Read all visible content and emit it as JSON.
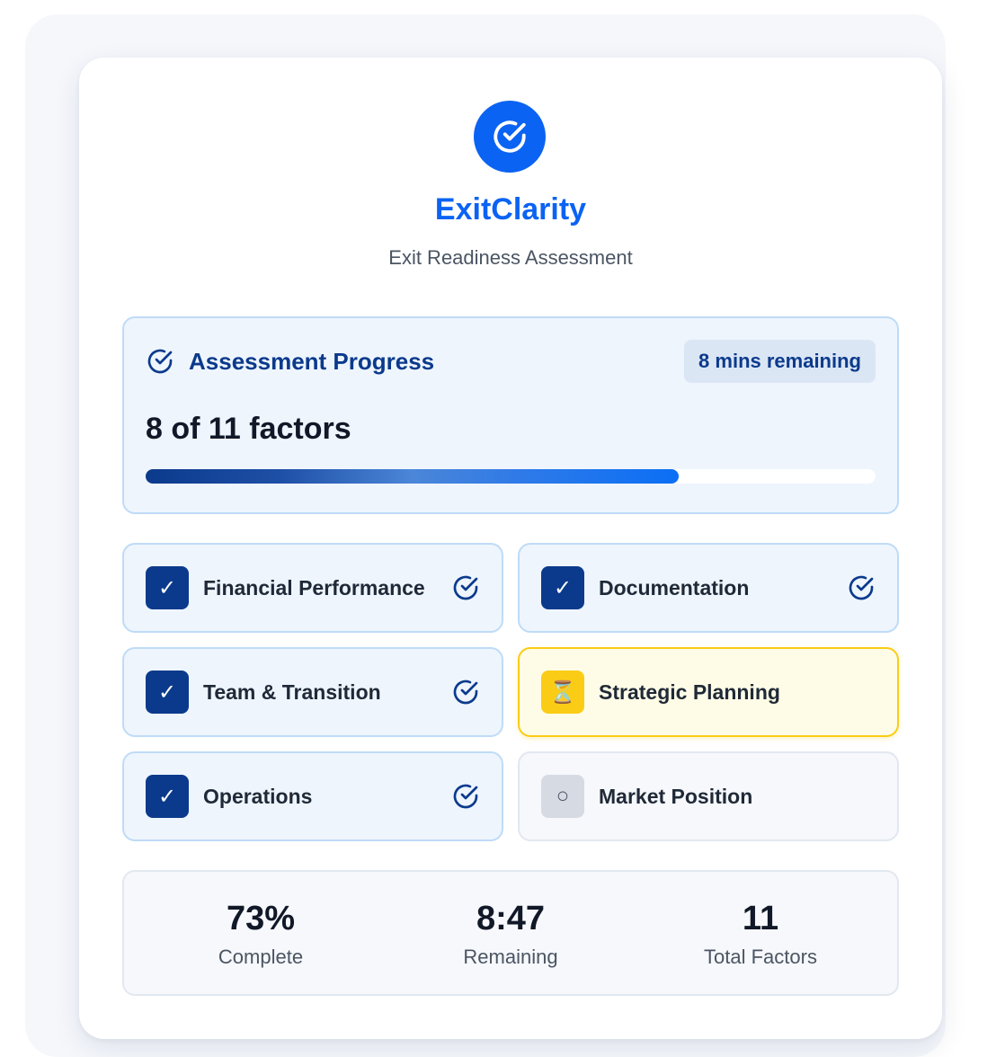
{
  "app": {
    "brand": "ExitClarity",
    "subtitle": "Exit Readiness Assessment",
    "logo_icon": "check-circle-icon",
    "accent_color": "#0b63f3"
  },
  "progress": {
    "title": "Assessment Progress",
    "time_badge": "8 mins remaining",
    "count_text": "8 of 11 factors",
    "percent": 73
  },
  "factors": [
    {
      "label": "Financial Performance",
      "status": "complete",
      "box_glyph": "✓"
    },
    {
      "label": "Documentation",
      "status": "complete",
      "box_glyph": "✓"
    },
    {
      "label": "Team & Transition",
      "status": "complete",
      "box_glyph": "✓"
    },
    {
      "label": "Strategic Planning",
      "status": "in-progress",
      "box_glyph": "⏳"
    },
    {
      "label": "Operations",
      "status": "complete",
      "box_glyph": "✓"
    },
    {
      "label": "Market Position",
      "status": "not-started",
      "box_glyph": "○"
    }
  ],
  "stats": [
    {
      "value": "73%",
      "label": "Complete"
    },
    {
      "value": "8:47",
      "label": "Remaining"
    },
    {
      "value": "11",
      "label": "Total Factors"
    }
  ]
}
